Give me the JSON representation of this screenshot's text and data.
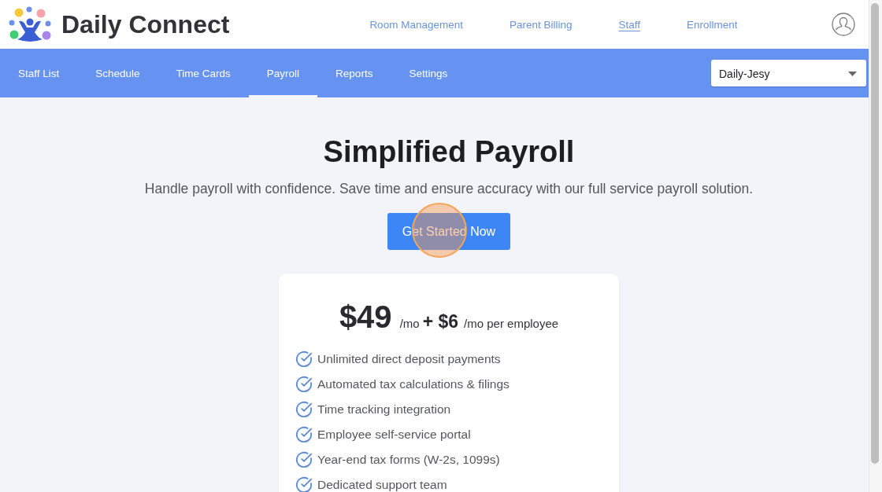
{
  "header": {
    "logo_text": "Daily Connect",
    "nav": [
      {
        "label": "Room Management",
        "selected": false
      },
      {
        "label": "Parent Billing",
        "selected": false
      },
      {
        "label": "Staff",
        "selected": true
      },
      {
        "label": "Enrollment",
        "selected": false
      }
    ]
  },
  "subnav": {
    "tabs": [
      {
        "label": "Staff List",
        "selected": false
      },
      {
        "label": "Schedule",
        "selected": false
      },
      {
        "label": "Time Cards",
        "selected": false
      },
      {
        "label": "Payroll",
        "selected": true
      },
      {
        "label": "Reports",
        "selected": false
      },
      {
        "label": "Settings",
        "selected": false
      }
    ],
    "location_select": {
      "value": "Daily-Jesy"
    }
  },
  "hero": {
    "title": "Simplified Payroll",
    "subtitle": "Handle payroll with confidence. Save time and ensure accuracy with our full service payroll solution.",
    "button": "Get Started Now"
  },
  "pricing": {
    "price": "$49",
    "price_unit": "/mo",
    "extra_price": "+ $6",
    "extra_unit": "/mo per employee",
    "features": [
      "Unlimited direct deposit payments",
      "Automated tax calculations & filings",
      "Time tracking integration",
      "Employee self-service portal",
      "Year-end tax forms (W-2s, 1099s)",
      "Dedicated support team"
    ]
  }
}
